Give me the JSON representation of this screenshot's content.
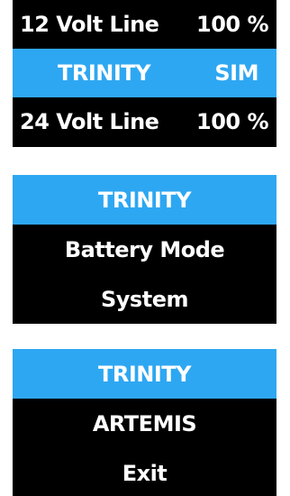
{
  "status_panel": {
    "rows": [
      {
        "label": "12 Volt Line",
        "value": "100 %"
      },
      {
        "label": "TRINITY",
        "value": "SIM"
      },
      {
        "label": "24 Volt Line",
        "value": "100 %"
      }
    ]
  },
  "menu_1": {
    "items": [
      "TRINITY",
      "Battery Mode",
      "System"
    ]
  },
  "menu_2": {
    "items": [
      "TRINITY",
      "ARTEMIS",
      "Exit"
    ]
  },
  "colors": {
    "highlight": "#2ea7f2",
    "background": "#000000",
    "text": "#ffffff"
  }
}
